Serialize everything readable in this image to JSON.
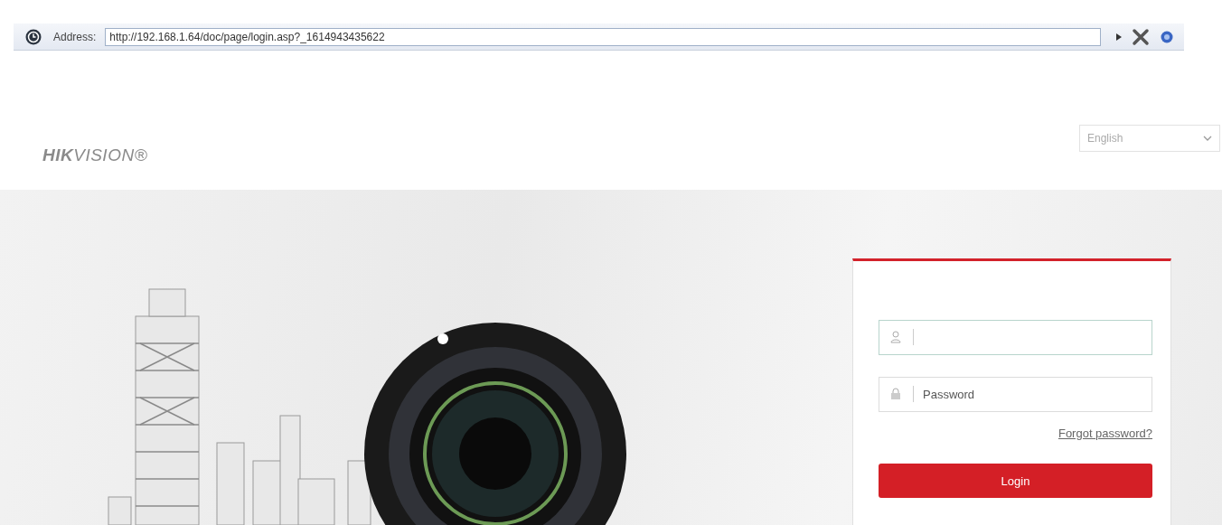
{
  "address_bar": {
    "label": "Address:",
    "url": "http://192.168.1.64/doc/page/login.asp?_1614943435622"
  },
  "header": {
    "logo": "**HIK**VISION®",
    "language": "English"
  },
  "login": {
    "username": {
      "focused": true
    },
    "password": {
      "placeholder": "Password"
    },
    "forgot_link": "Forgot password?",
    "login_button": "Login"
  }
}
